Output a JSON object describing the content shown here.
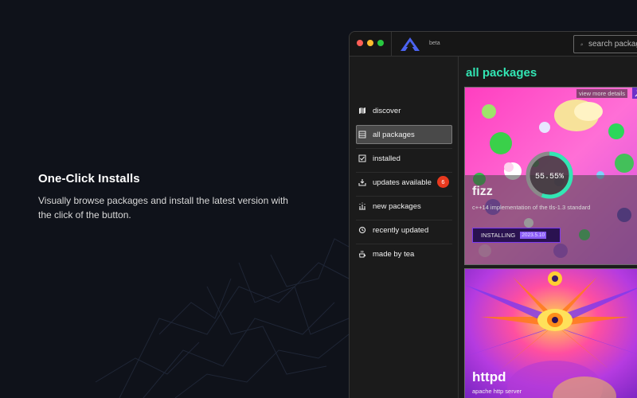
{
  "promo": {
    "title": "One-Click Installs",
    "description": "Visually browse packages and install the latest version with the click of the button."
  },
  "window": {
    "beta_label": "beta",
    "search": {
      "placeholder": "search packages"
    }
  },
  "sidebar": {
    "items": [
      {
        "label": "discover",
        "icon": "map-icon"
      },
      {
        "label": "all packages",
        "icon": "grid-icon",
        "active": true
      },
      {
        "label": "installed",
        "icon": "check-square-icon"
      },
      {
        "label": "updates available",
        "icon": "download-icon",
        "badge": "6"
      },
      {
        "label": "new packages",
        "icon": "sparkle-icon"
      },
      {
        "label": "recently updated",
        "icon": "history-icon"
      },
      {
        "label": "made by tea",
        "icon": "tea-icon"
      }
    ]
  },
  "main": {
    "title": "all packages",
    "packages": [
      {
        "name": "fizz",
        "description": "c++14 implementation of the tls-1.3 standard",
        "view_more": "view more details",
        "status": "INSTALLING",
        "version": "2023.5.10",
        "progress_text": "55.55%",
        "progress": 0.5555
      },
      {
        "name": "httpd",
        "description": "apache http server"
      }
    ]
  },
  "colors": {
    "accent": "#32e6b4",
    "badge": "#e8391e",
    "install_border": "#7c3aed"
  }
}
